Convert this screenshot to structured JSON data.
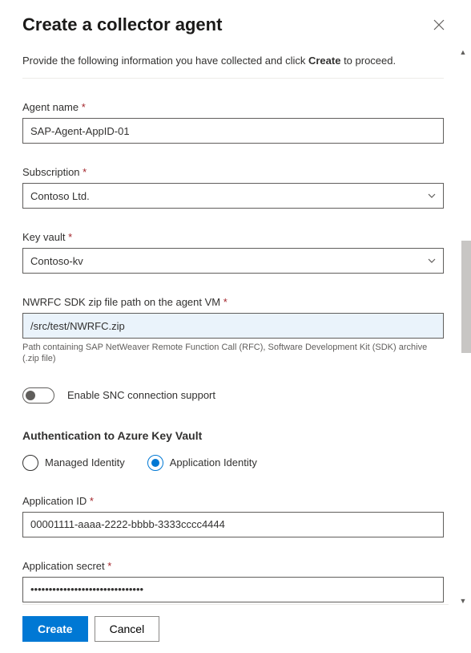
{
  "header": {
    "title": "Create a collector agent"
  },
  "intro": {
    "prefix": "Provide the following information you have collected and click ",
    "bold": "Create",
    "suffix": " to proceed."
  },
  "fields": {
    "agent_name": {
      "label": "Agent name",
      "value": "SAP-Agent-AppID-01",
      "required": "*"
    },
    "subscription": {
      "label": "Subscription",
      "value": "Contoso Ltd.",
      "required": "*"
    },
    "key_vault": {
      "label": "Key vault",
      "value": "Contoso-kv",
      "required": "*"
    },
    "sdk_path": {
      "label": "NWRFC SDK zip file path on the agent VM",
      "value": "/src/test/NWRFC.zip",
      "required": "*",
      "help": "Path containing SAP NetWeaver Remote Function Call (RFC), Software Development Kit (SDK) archive (.zip file)"
    },
    "snc_toggle": {
      "label": "Enable SNC connection support"
    },
    "auth_section": {
      "heading": "Authentication to Azure Key Vault",
      "options": {
        "managed": "Managed Identity",
        "application": "Application Identity"
      }
    },
    "app_id": {
      "label": "Application ID",
      "value": "00001111-aaaa-2222-bbbb-3333cccc4444",
      "required": "*"
    },
    "app_secret": {
      "label": "Application secret",
      "value": "•••••••••••••••••••••••••••••••",
      "required": "*"
    }
  },
  "footer": {
    "create": "Create",
    "cancel": "Cancel"
  }
}
